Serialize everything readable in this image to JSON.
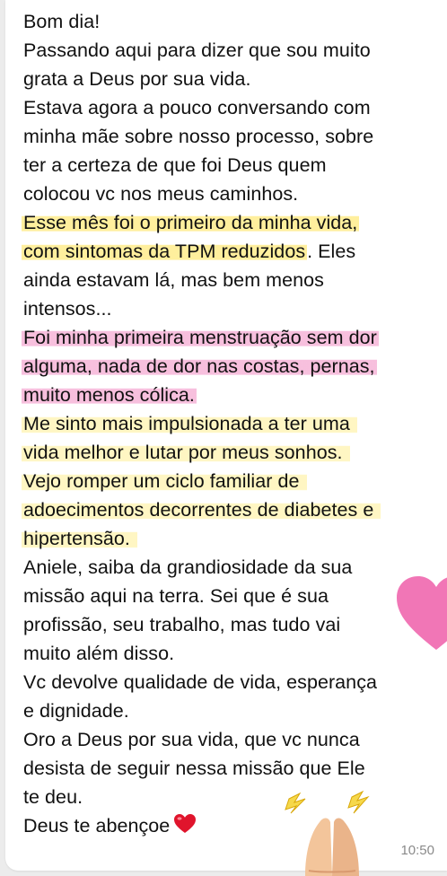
{
  "message": {
    "lines": [
      {
        "text": "Bom dia!",
        "highlight": "none"
      },
      {
        "text": "Passando aqui para dizer que sou muito",
        "highlight": "none"
      },
      {
        "text": "grata a Deus por sua vida.",
        "highlight": "none"
      },
      {
        "text": "Estava agora a pouco conversando com",
        "highlight": "none"
      },
      {
        "text": "minha mãe sobre nosso processo, sobre",
        "highlight": "none"
      },
      {
        "text": "ter a certeza de que foi Deus quem",
        "highlight": "none"
      },
      {
        "text": "colocou vc nos meus caminhos.",
        "highlight": "none"
      },
      {
        "text": "Esse mês foi o primeiro da minha vida,",
        "highlight": "yellow"
      },
      {
        "text": "com sintomas da TPM reduzidos",
        "highlight": "yellow",
        "rest": ". Eles"
      },
      {
        "text": "ainda estavam lá, mas bem menos",
        "highlight": "none"
      },
      {
        "text": "intensos...",
        "highlight": "none"
      },
      {
        "text": "Foi minha primeira menstruação sem dor",
        "highlight": "pink"
      },
      {
        "text": "alguma, nada de dor nas costas, pernas,",
        "highlight": "pink"
      },
      {
        "text": "muito menos cólica.",
        "highlight": "pink"
      },
      {
        "text": "Me sinto mais impulsionada a ter uma",
        "highlight": "yellow-soft"
      },
      {
        "text": "vida melhor e lutar por meus sonhos.",
        "highlight": "yellow-soft"
      },
      {
        "text": "Vejo romper um ciclo familiar de",
        "highlight": "yellow-soft"
      },
      {
        "text": "adoecimentos decorrentes de diabetes e",
        "highlight": "yellow-soft"
      },
      {
        "text": "hipertensão.",
        "highlight": "yellow-soft"
      },
      {
        "text": "Aniele, saiba da grandiosidade da sua",
        "highlight": "none"
      },
      {
        "text": "missão aqui na terra. Sei que é sua",
        "highlight": "none"
      },
      {
        "text": "profissão, seu trabalho, mas tudo vai",
        "highlight": "none"
      },
      {
        "text": "muito além disso.",
        "highlight": "none"
      },
      {
        "text": "Vc devolve qualidade de vida, esperança",
        "highlight": "none"
      },
      {
        "text": "e dignidade.",
        "highlight": "none"
      },
      {
        "text": "Oro a Deus por sua vida, que vc nunca",
        "highlight": "none"
      },
      {
        "text": "desista de seguir nessa missão que Ele",
        "highlight": "none"
      },
      {
        "text": "te deu.",
        "highlight": "none"
      },
      {
        "text": "Deus te abençoe",
        "highlight": "none",
        "emoji": "red-heart"
      }
    ],
    "timestamp": "10:50"
  },
  "colors": {
    "highlight_yellow": "#ffec8c",
    "highlight_pink": "#f4aad2",
    "heart_sticker": "#f06ab0",
    "text": "#111111",
    "timestamp": "#8a8a8a"
  },
  "decorations": {
    "sticker_heart": "pink-heart-icon",
    "sticker_hands": "praying-hands-icon"
  }
}
